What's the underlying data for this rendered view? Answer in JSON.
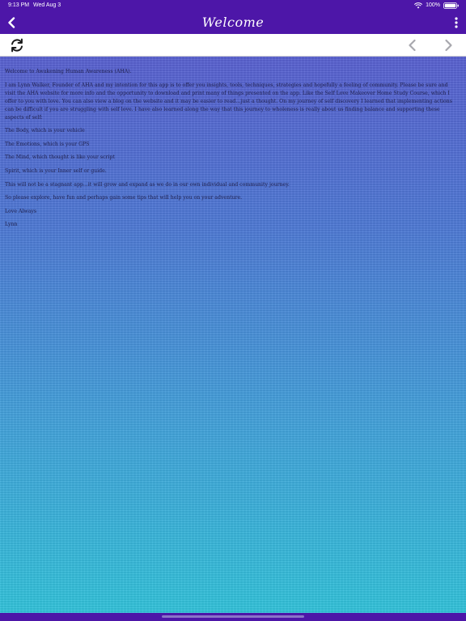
{
  "status": {
    "time": "9:13 PM",
    "date": "Wed Aug 3",
    "battery": "100%"
  },
  "nav": {
    "title": "Welcome",
    "back_icon": "chevron-left-icon",
    "more_icon": "vertical-ellipsis-icon"
  },
  "toolbar": {
    "refresh_icon": "refresh-icon",
    "prev_icon": "chevron-left-icon",
    "next_icon": "chevron-right-icon"
  },
  "article": {
    "paragraphs": [
      "Welcome to Awakening Human Awareness (AHA).",
      "I am Lynn Walker, Founder of AHA and my intention for this app is to offer you insights, tools, techniques, strategies and hopefully a feeling of community. Please be sure and visit the AHA website for more info and the opportunity to download and print many of things presented on the app. Like the Self Love Makeover Home Study Course, which I offer to you with love. You can also view a blog on the website and it may be easier to read…just a thought. On my journey of self discovery I learned that implementing actions can be difficult if you are struggling with self love. I have also learned along the way that this journey to wholeness is really about us finding balance and supporting these aspects of self:",
      "The Body, which is your vehicle",
      "The Emotions, which is your GPS",
      "The Mind, which thought is like your script",
      "Spirit, which is your Inner self or guide.",
      "This will not be a stagnant app...it will grow and expand as we do in our own individual and community journey.",
      "So please explore, have fun and perhaps gain some tips that will help you on your adventure.",
      "Love Always",
      "Lynn"
    ]
  },
  "colors": {
    "bar_purple": "#4d16a8",
    "toolbar_white": "#ffffff",
    "text_dark": "#1e1e4a",
    "gradient_top": "#5a62d2",
    "gradient_bottom": "#33c4dc"
  }
}
